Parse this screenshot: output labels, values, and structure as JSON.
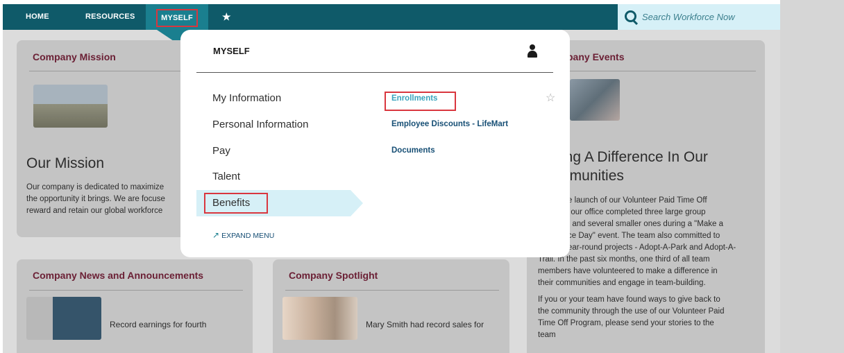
{
  "nav": {
    "home": "HOME",
    "resources": "RESOURCES",
    "myself": "MYSELF",
    "favorites_icon": "★"
  },
  "search": {
    "placeholder": "Search Workforce Now",
    "icon": "search-icon"
  },
  "cards": {
    "mission": {
      "title": "Company Mission",
      "heading": "Our Mission",
      "text_lines": [
        "Our company is dedicated to maximize",
        "the opportunity it brings. We are focuse",
        "reward and retain our global workforce"
      ]
    },
    "events": {
      "title": "pany Events",
      "heading_lines": [
        "ing A Difference In Our",
        "nmunities"
      ],
      "text_lines": [
        "e launch of our Volunteer Paid Time Off",
        ", our office completed three large group",
        ", and several smaller ones during a \"Make a",
        "ce Day\" event.  The team also committed to",
        "ear-round projects - Adopt-A-Park and Adopt-A-",
        "Trail.  In the past six months, one third of all team",
        "members have volunteered to make a difference in",
        "their communities and engage in team-building."
      ],
      "text_lines_2": [
        "If you or your team have found ways to give back to",
        "the community through the use of our Volunteer Paid",
        "Time Off Program, please send your stories to the",
        "team"
      ]
    },
    "news": {
      "title": "Company News and Announcements",
      "snippet": "Record earnings for fourth"
    },
    "spotlight": {
      "title": "Company Spotlight",
      "snippet": "Mary Smith had record sales for"
    }
  },
  "menu": {
    "title": "MYSELF",
    "items": [
      "My Information",
      "Personal Information",
      "Pay",
      "Talent",
      "Benefits"
    ],
    "selected": "Benefits",
    "sublinks": [
      "Enrollments",
      "Employee Discounts - LifeMart",
      "Documents"
    ],
    "expand": "EXPAND MENU",
    "expand_icon": "↗",
    "star_icon": "☆"
  },
  "colors": {
    "nav_bg": "#0f5a69",
    "nav_active": "#1a7f8f",
    "accent_highlight": "#d9363e",
    "link_blue": "#174f75",
    "link_light": "#3aa3bd",
    "card_title": "#6b2035",
    "selected_band": "#d6f0f7"
  }
}
